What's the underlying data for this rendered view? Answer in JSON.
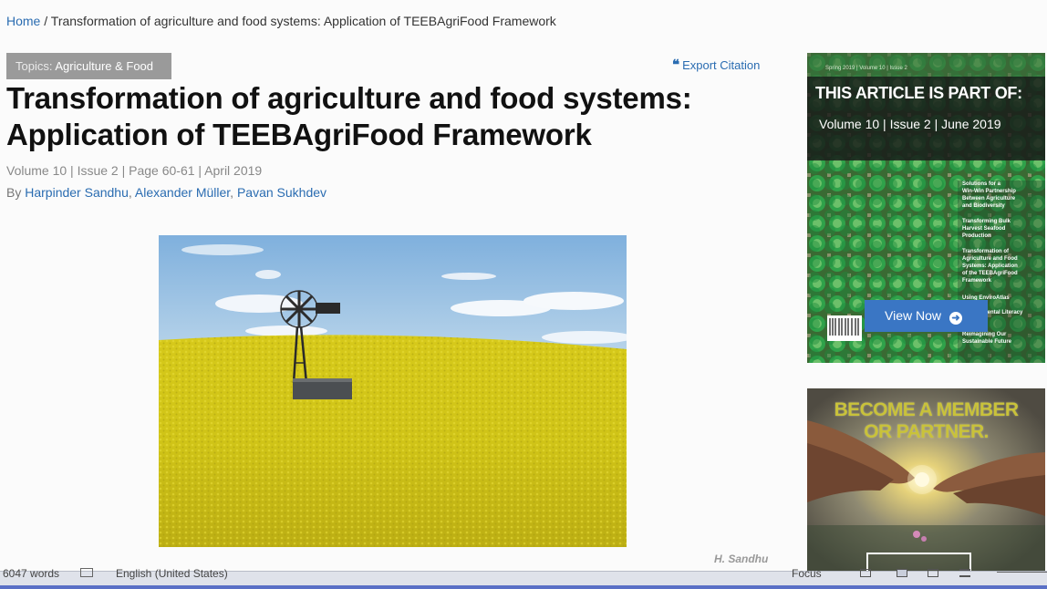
{
  "breadcrumb": {
    "home": "Home",
    "separator": " / ",
    "current": "Transformation of agriculture and food systems: Application of TEEBAgriFood Framework"
  },
  "topic": {
    "prefix": "Topics: ",
    "value": "Agriculture & Food"
  },
  "export": {
    "icon": "quote-icon",
    "quote_glyph": "❝",
    "label": "Export Citation"
  },
  "article": {
    "title": "Transformation of agriculture and food systems: Application of TEEBAgriFood Framework",
    "meta": "Volume 10 | Issue 2 | Page 60-61 | April 2019",
    "by": "By ",
    "authors": [
      "Harpinder Sandhu",
      "Alexander Müller",
      "Pavan Sukhdev"
    ],
    "author_sep": ", ",
    "image_credit": "H. Sandhu"
  },
  "sidebar": {
    "cover": {
      "heading": "THIS ARTICLE IS PART OF:",
      "issue": "Volume 10 | Issue 2 | June 2019",
      "button": "View Now",
      "button_icon": "arrow-right-circle-icon",
      "arrow_glyph": "➜"
    },
    "member": {
      "line1": "BECOME A MEMBER",
      "line2": "OR PARTNER."
    }
  },
  "statusbar": {
    "words": "6047 words",
    "language": "English (United States)",
    "focus": "Focus"
  },
  "colors": {
    "link": "#2a6cb1",
    "topic_bg": "#9a9a9a",
    "button_blue": "#3a76c4",
    "field_yellow": "#d9cc12",
    "member_text": "#c9c23a"
  }
}
